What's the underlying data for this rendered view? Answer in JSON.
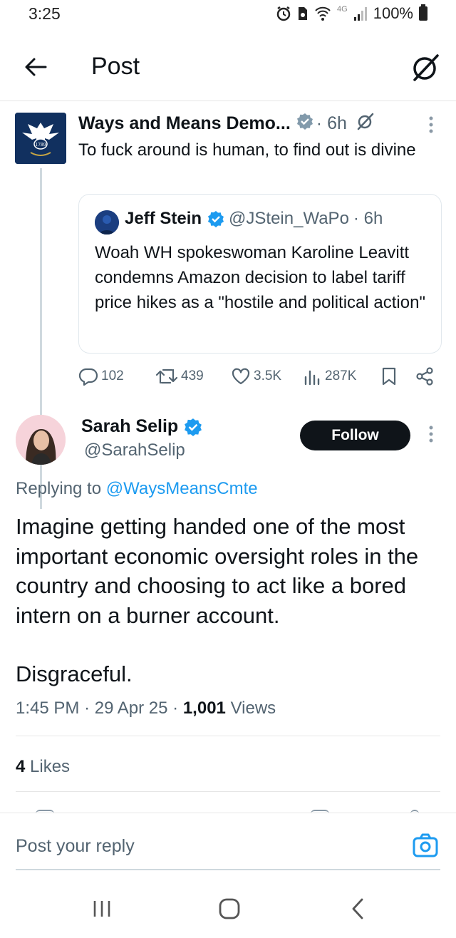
{
  "status_bar": {
    "time": "3:25",
    "network": "4G",
    "battery": "100%"
  },
  "header": {
    "title": "Post"
  },
  "quoted_post": {
    "author_name": "Ways and Means Demo...",
    "time": "6h",
    "text": "To fuck around is human, to find out is divine",
    "avatar_text": "1789",
    "embed": {
      "author_name": "Jeff Stein",
      "handle": "@JStein_WaPo",
      "time": "6h",
      "text": "Woah WH spokeswoman Karoline Leavitt condemns Amazon decision to label tariff price hikes as a \"hostile and political action\""
    },
    "stats": {
      "replies": "102",
      "reposts": "439",
      "likes": "3.5K",
      "views": "287K"
    }
  },
  "main_post": {
    "author_name": "Sarah Selip",
    "handle": "@SarahSelip",
    "follow_label": "Follow",
    "replying_to_label": "Replying to",
    "replying_to_handle": "@WaysMeansCmte",
    "text": "Imagine getting handed one of the most important economic oversight roles in the country and choosing to act like a bored intern on a burner account.",
    "text2": "Disgraceful.",
    "time": "1:45 PM",
    "date": "29 Apr 25",
    "views_count": "1,001",
    "views_label": "Views",
    "likes_count": "4",
    "likes_label": "Likes"
  },
  "reply_bar": {
    "placeholder": "Post your reply"
  },
  "icons": {
    "back": "arrow-left-icon",
    "grok": "grok-icon",
    "verified": "verified-badge-icon",
    "reply": "reply-icon",
    "repost": "repost-icon",
    "like": "heart-icon",
    "views": "views-icon",
    "bookmark": "bookmark-icon",
    "share": "share-icon",
    "camera": "camera-icon"
  },
  "colors": {
    "accent": "#1d9bf0",
    "text": "#0f1419",
    "muted": "#536471",
    "verified_grey": "#829aab"
  }
}
